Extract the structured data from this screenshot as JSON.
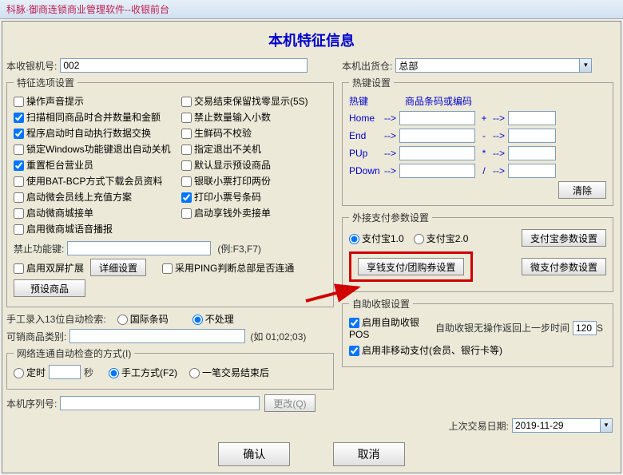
{
  "titlebar": "科脉·御商连锁商业管理软件--收银前台",
  "titles": {
    "main": "本机特征信息"
  },
  "top": {
    "pos_label": "本收银机号:",
    "pos_value": "002",
    "warehouse_label": "本机出货仓:",
    "warehouse_value": "总部"
  },
  "feature_group": "特征选项设置",
  "cb_left": [
    {
      "label": "操作声音提示",
      "checked": false
    },
    {
      "label": "扫描相同商品时合并数量和金额",
      "checked": true
    },
    {
      "label": "程序启动时自动执行数据交换",
      "checked": true
    },
    {
      "label": "锁定Windows功能键退出自动关机",
      "checked": false
    },
    {
      "label": "重置柜台营业员",
      "checked": true
    },
    {
      "label": "使用BAT-BCP方式下载会员资料",
      "checked": false
    },
    {
      "label": "启动微会员线上充值方案",
      "checked": false
    },
    {
      "label": "启动微商城接单",
      "checked": false
    },
    {
      "label": "启用微商城语音播报",
      "checked": false
    }
  ],
  "cb_right": [
    {
      "label": "交易结束保留找零显示(5S)",
      "checked": false
    },
    {
      "label": "禁止数量输入小数",
      "checked": false
    },
    {
      "label": "生鲜码不校验",
      "checked": false
    },
    {
      "label": "指定退出不关机",
      "checked": false
    },
    {
      "label": "默认显示预设商品",
      "checked": false
    },
    {
      "label": "银联小票打印两份",
      "checked": false
    },
    {
      "label": "打印小票号条码",
      "checked": true
    },
    {
      "label": "启动享钱外卖接单",
      "checked": false
    }
  ],
  "forbid": {
    "label": "禁止功能键:",
    "hint": "(例:F3,F7)"
  },
  "dualscreen": {
    "label": "启用双屏扩展",
    "detail_btn": "详细设置",
    "ping_label": "采用PING判断总部是否连通"
  },
  "preset_btn": "预设商品",
  "hotkey_group": "热键设置",
  "hotkey_hdr": {
    "a": "热键",
    "b": "商品条码或编码"
  },
  "hotkeys": [
    {
      "k": "Home",
      "op": "+"
    },
    {
      "k": "End",
      "op": "-"
    },
    {
      "k": "PUp",
      "op": "*"
    },
    {
      "k": "PDown",
      "op": "/"
    }
  ],
  "clear_btn": "清除",
  "pay_group": "外接支付参数设置",
  "pay": {
    "al1": "支付宝1.0",
    "al2": "支付宝2.0",
    "al_btn": "支付宝参数设置",
    "xq_btn": "享钱支付/团购券设置",
    "wx_btn": "微支付参数设置"
  },
  "self_group": "自助收银设置",
  "self": {
    "cb1": "启用自助收银POS",
    "idle": "自助收银无操作返回上一步时间",
    "idle_val": "120",
    "idle_unit": "S",
    "cb2": "启用非移动支付(会员、银行卡等)"
  },
  "manual": {
    "label": "手工录入13位自动检索:",
    "r1": "国际条码",
    "r2": "不处理"
  },
  "saleable": {
    "label": "可销商品类别:",
    "hint": "(如 01;02;03)"
  },
  "netcheck": {
    "group": "网络连通自动检查的方式(I)",
    "r1": "定时",
    "sec": "秒",
    "r2": "手工方式(F2)",
    "r3": "一笔交易结束后"
  },
  "serial": {
    "label": "本机序列号:",
    "change_btn": "更改(Q)"
  },
  "lasttrade": {
    "label": "上次交易日期:",
    "value": "2019-11-29"
  },
  "footer": {
    "ok": "确认",
    "cancel": "取消"
  }
}
